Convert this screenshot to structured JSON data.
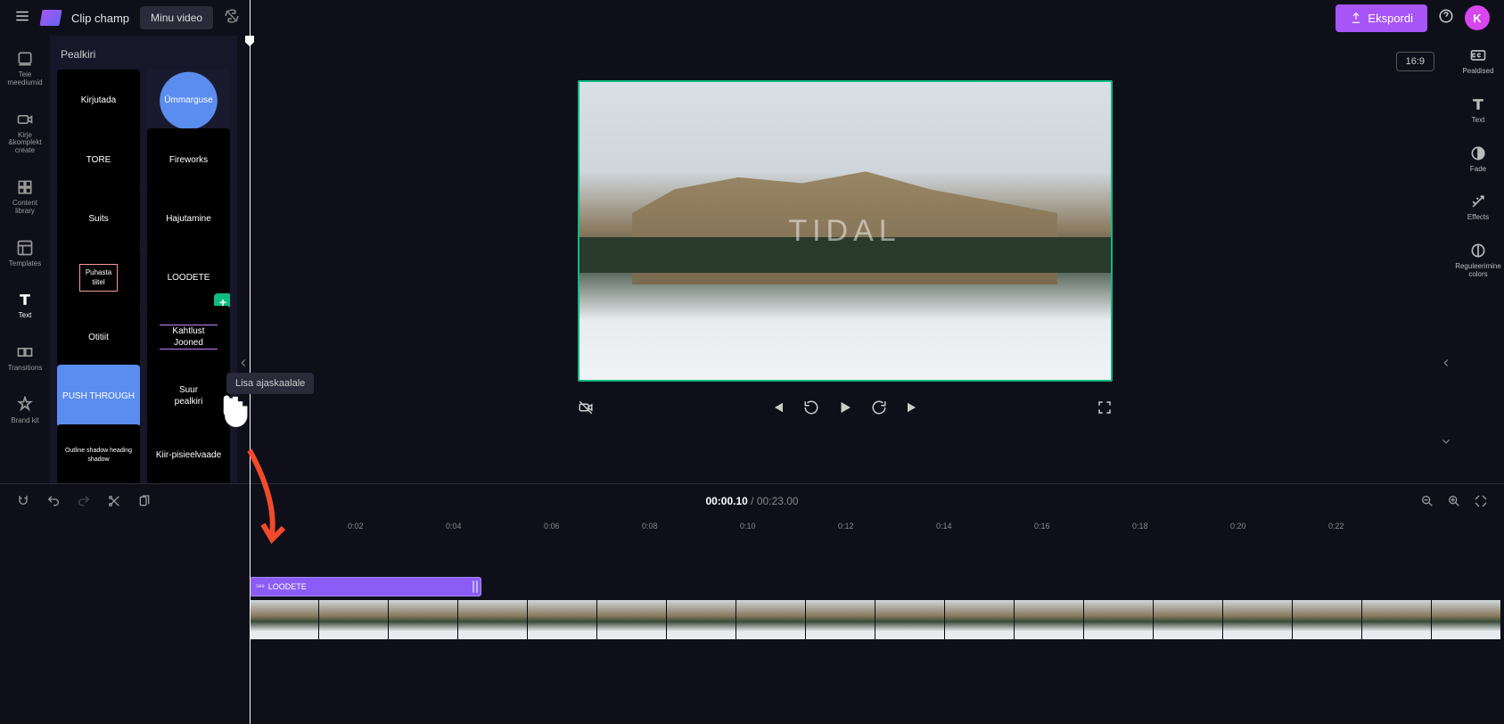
{
  "app": {
    "name": "Clip champ",
    "video_name": "Minu video"
  },
  "top": {
    "export_label": "Ekspordi",
    "avatar_initial": "K"
  },
  "left_nav": [
    {
      "icon": "media",
      "label": "Teie meediumid"
    },
    {
      "icon": "record",
      "label": "Kirje &amp;komplekt\ncreate"
    },
    {
      "icon": "content",
      "label": "Content\nlibrary"
    },
    {
      "icon": "templates",
      "label": "Templates"
    },
    {
      "icon": "text",
      "label": "Text",
      "active": true
    },
    {
      "icon": "transitions",
      "label": "Transitions"
    },
    {
      "icon": "brand",
      "label": "Brand kit"
    }
  ],
  "panel": {
    "heading": "Pealkiri"
  },
  "titles": [
    {
      "label": "Kirjutada",
      "style": "plain"
    },
    {
      "label": "Ümmarguse",
      "style": "circle-bg"
    },
    {
      "label": "TORE",
      "style": "plain"
    },
    {
      "label": "Fireworks",
      "style": "plain"
    },
    {
      "label": "Suits",
      "style": "plain"
    },
    {
      "label": "Hajutamine",
      "style": "plain"
    },
    {
      "label": "Puhasta\ntiitel",
      "style": "boxed-inner"
    },
    {
      "label": "LOODETE",
      "style": "plain",
      "has_add": true
    },
    {
      "label": "Otitiit",
      "style": "plain"
    },
    {
      "label": "Kahtlust\nJooned",
      "style": "underline-lines"
    },
    {
      "label": "PUSH THROUGH",
      "style": "push-through"
    },
    {
      "label": "Suur\npealkiri",
      "style": "plain"
    },
    {
      "label": "Outline shadow heading\nshadow",
      "style": "plain-small"
    },
    {
      "label": "Kiir-pisieelvaade",
      "style": "plain"
    }
  ],
  "tooltip_text": "Lisa ajaskaalale",
  "preview": {
    "overlay_text": "TIDAL",
    "aspect_label": "16:9"
  },
  "right_rail": [
    {
      "icon": "cc",
      "label": "Pealdised"
    },
    {
      "icon": "text",
      "label": "Text"
    },
    {
      "icon": "fade",
      "label": "Fade"
    },
    {
      "icon": "effects",
      "label": "Effects"
    },
    {
      "icon": "colors",
      "label": "Reguleerimine\ncolors"
    }
  ],
  "timeline": {
    "current": "00:00.10",
    "total": "00:23.00",
    "ticks": [
      "0:02",
      "0:04",
      "0:06",
      "0:08",
      "0:10",
      "0:12",
      "0:14",
      "0:16",
      "0:18",
      "0:20",
      "0:22"
    ],
    "title_clip_label": "LOODETE"
  }
}
